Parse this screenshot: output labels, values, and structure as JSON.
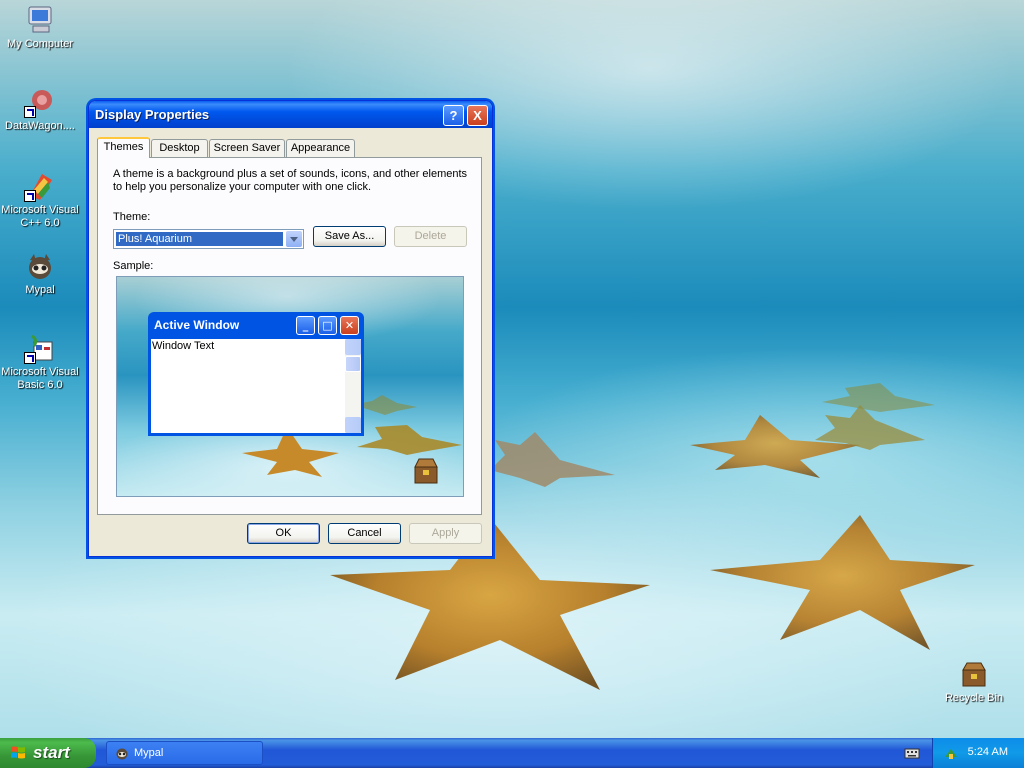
{
  "desktop": {
    "icons": [
      {
        "label": "My Computer",
        "icon": "my-computer-icon"
      },
      {
        "label": "DataWagon....",
        "icon": "datawagon-icon"
      },
      {
        "label": "Microsoft Visual C++ 6.0",
        "icon": "visual-cpp-icon"
      },
      {
        "label": "Mypal",
        "icon": "mypal-icon"
      },
      {
        "label": "Microsoft Visual Basic 6.0",
        "icon": "visual-basic-icon"
      },
      {
        "label": "Recycle Bin",
        "icon": "recycle-bin-icon"
      }
    ]
  },
  "dialog": {
    "title": "Display Properties",
    "help_button": "?",
    "close_button": "X",
    "tabs": [
      "Themes",
      "Desktop",
      "Screen Saver",
      "Appearance"
    ],
    "active_tab": "Themes",
    "description": "A theme is a background plus a set of sounds, icons, and other elements to help you personalize your computer with one click.",
    "theme_label": "Theme:",
    "theme_value": "Plus! Aquarium",
    "save_as_label": "Save As...",
    "delete_label": "Delete",
    "sample_label": "Sample:",
    "sample": {
      "window_title": "Active Window",
      "window_text": "Window Text"
    },
    "ok_label": "OK",
    "cancel_label": "Cancel",
    "apply_label": "Apply"
  },
  "taskbar": {
    "start_label": "start",
    "task_button_label": "Mypal",
    "clock": "5:24 AM"
  },
  "colors": {
    "title_bar": "#0054e3",
    "selection": "#316ac5",
    "start_button": "#3c9f3c",
    "tab_highlight": "#ffc83c"
  }
}
